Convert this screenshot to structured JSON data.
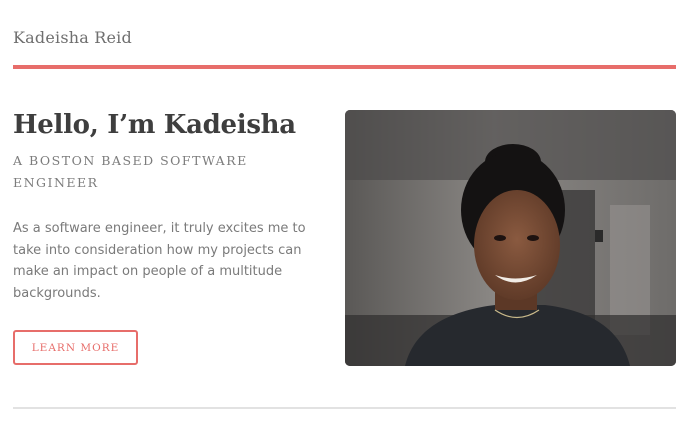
{
  "header": {
    "site_title": "Kadeisha Reid"
  },
  "hero": {
    "title": "Hello, I’m Kadeisha",
    "subtitle": "A Boston based software engineer",
    "body": "As a software engineer, it truly excites me to take into consideration how my projects can make an impact on people of a multitude backgrounds.",
    "button_label": "Learn More",
    "photo_alt": "Portrait of Kadeisha Reid"
  },
  "colors": {
    "accent": "#e76d6a",
    "heading": "#3e3e3e",
    "text": "#7a7a7a"
  }
}
